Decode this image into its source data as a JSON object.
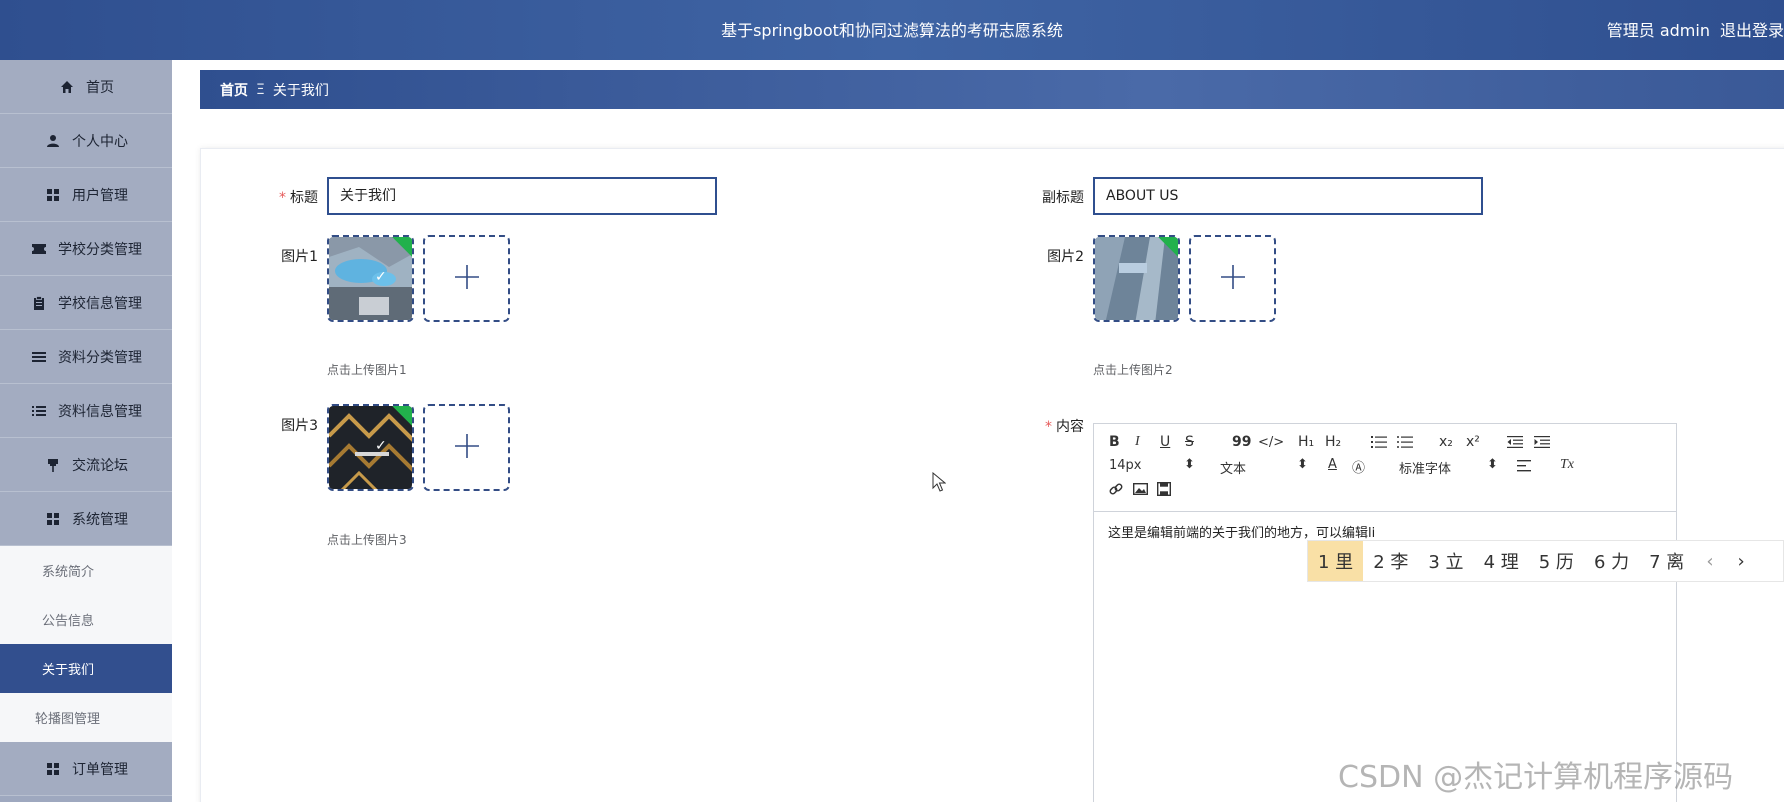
{
  "header": {
    "title": "基于springboot和协同过滤算法的考研志愿系统",
    "user_label": "管理员 admin",
    "logout_label": "退出登录"
  },
  "sidebar": {
    "items": [
      {
        "label": "首页",
        "icon": "home-icon"
      },
      {
        "label": "个人中心",
        "icon": "user-icon"
      },
      {
        "label": "用户管理",
        "icon": "grid-icon"
      },
      {
        "label": "学校分类管理",
        "icon": "ticket-icon"
      },
      {
        "label": "学校信息管理",
        "icon": "clipboard-icon"
      },
      {
        "label": "资料分类管理",
        "icon": "list-icon"
      },
      {
        "label": "资料信息管理",
        "icon": "list-ordered-icon"
      },
      {
        "label": "交流论坛",
        "icon": "pin-icon"
      },
      {
        "label": "系统管理",
        "icon": "grid-icon"
      }
    ],
    "sub_items": [
      {
        "label": "系统简介"
      },
      {
        "label": "公告信息"
      },
      {
        "label": "关于我们"
      },
      {
        "label": "轮播图管理"
      }
    ],
    "last_item": {
      "label": "订单管理",
      "icon": "grid-icon"
    }
  },
  "breadcrumb": {
    "home": "首页",
    "separator": "Ξ",
    "current": "关于我们"
  },
  "form": {
    "title_label": "标题",
    "title_value": "关于我们",
    "subtitle_label": "副标题",
    "subtitle_value": "ABOUT US",
    "pic1_label": "图片1",
    "pic1_hint": "点击上传图片1",
    "pic2_label": "图片2",
    "pic2_hint": "点击上传图片2",
    "pic3_label": "图片3",
    "pic3_hint": "点击上传图片3",
    "content_label": "内容",
    "required_mark": "*"
  },
  "editor": {
    "bold": "B",
    "italic": "I",
    "underline": "U",
    "strike": "S",
    "quote": "99",
    "code": "</>",
    "h1": "H₁",
    "h2": "H₂",
    "subscript": "x₂",
    "superscript": "x²",
    "font_size": "14px",
    "text_type": "文本",
    "font_family": "标准字体",
    "clear": "Tx",
    "content": "这里是编辑前端的关于我们的地方，可以编辑li"
  },
  "ime": {
    "candidates": [
      "1 里",
      "2 李",
      "3 立",
      "4 理",
      "5 历",
      "6 力",
      "7 离"
    ]
  },
  "watermark": "CSDN @杰记计算机程序源码"
}
